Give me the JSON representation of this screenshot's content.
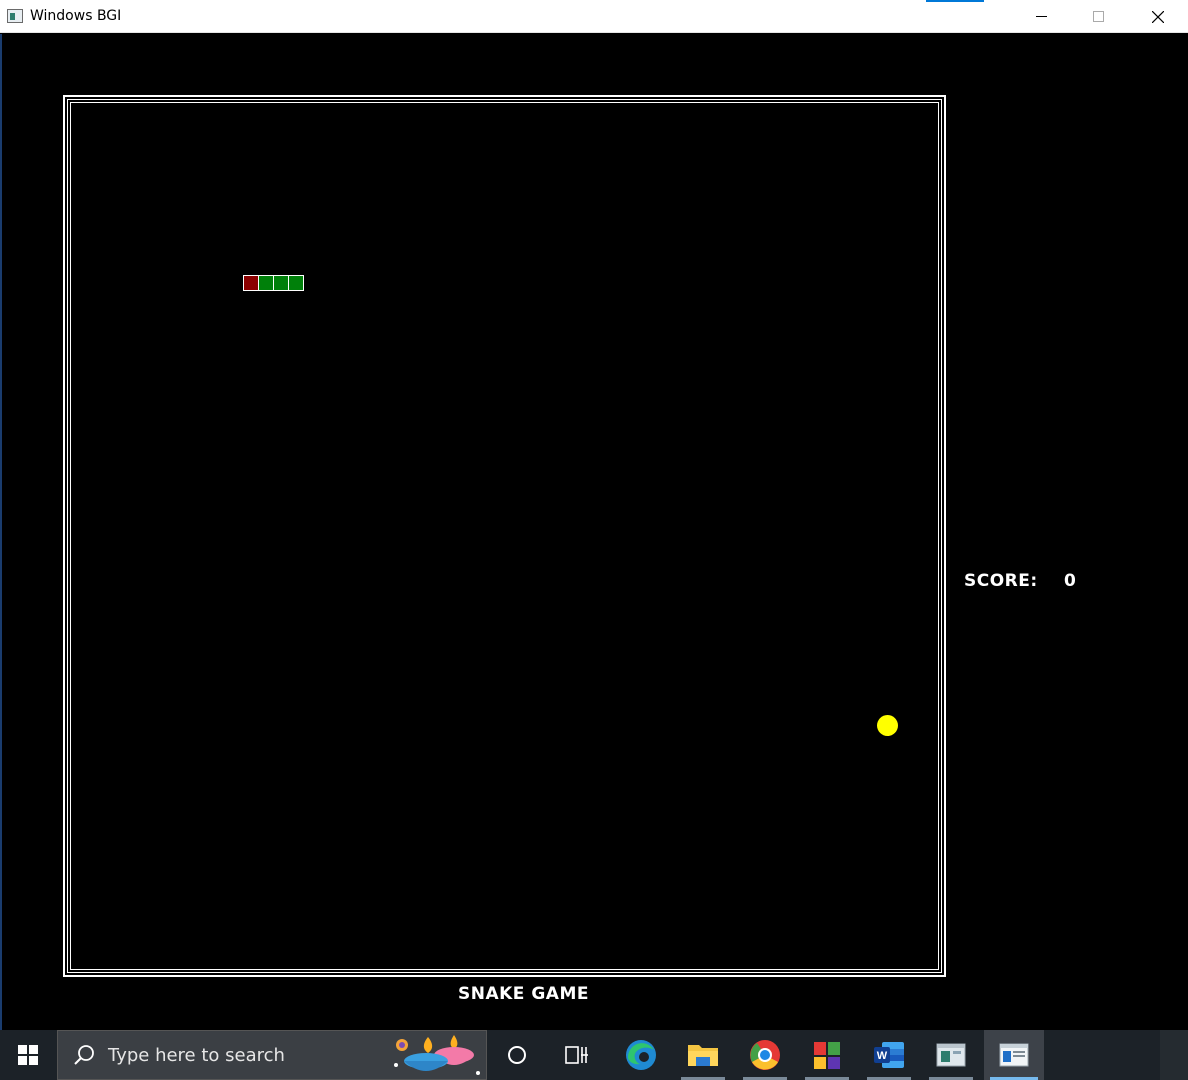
{
  "window": {
    "title": "Windows BGI"
  },
  "game": {
    "title": "SNAKE GAME",
    "score_label": "SCORE:",
    "score_value": "0"
  },
  "colors": {
    "snake_head": "#8b0000",
    "snake_body": "#00800a",
    "food": "#ffff00",
    "background": "#000000",
    "border": "#ffffff"
  },
  "taskbar": {
    "search_placeholder": "Type here to search",
    "apps": [
      "edge",
      "file-explorer",
      "chrome",
      "store",
      "word",
      "windows-bgi",
      "windows-bgi"
    ]
  }
}
